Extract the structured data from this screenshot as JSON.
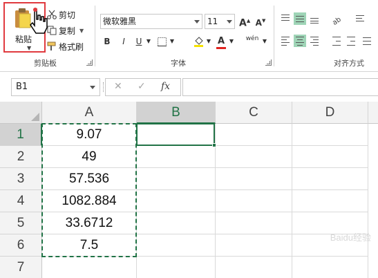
{
  "ribbon": {
    "clipboard": {
      "paste_label": "粘贴",
      "cut_label": "剪切",
      "copy_label": "复制",
      "format_painter_label": "格式刷",
      "group_label": "剪贴板"
    },
    "font": {
      "font_name": "微软雅黑",
      "font_size": "11",
      "bold": "B",
      "italic": "I",
      "underline": "U",
      "grow": "A",
      "shrink": "A",
      "font_color_letter": "A",
      "phonetic": "wén",
      "group_label": "字体"
    },
    "alignment": {
      "group_label": "对齐方式"
    }
  },
  "formula_bar": {
    "name_box": "B1",
    "fx": "fx",
    "cancel_symbol": "✕",
    "enter_symbol": "✓",
    "formula": ""
  },
  "sheet": {
    "columns": [
      "A",
      "B",
      "C",
      "D"
    ],
    "rows": [
      "1",
      "2",
      "3",
      "4",
      "5",
      "6",
      "7"
    ],
    "column_a_values": [
      "9.07",
      "49",
      "57.536",
      "1082.884",
      "33.6712",
      "7.5"
    ],
    "selected_cell": "B1"
  },
  "colors": {
    "accent_green": "#217346",
    "highlight_red": "#e0393e"
  },
  "icons": [
    "paste-icon",
    "scissors-icon",
    "copy-icon",
    "format-painter-icon",
    "hand-cursor-icon",
    "paint-bucket-icon",
    "font-color-icon"
  ],
  "watermark": "Baidu经验"
}
